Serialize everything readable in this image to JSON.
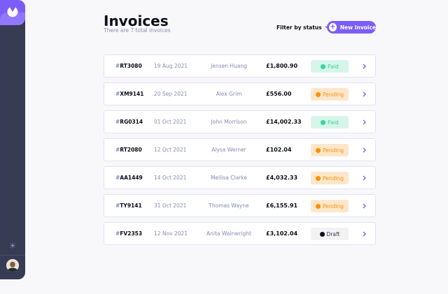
{
  "header": {
    "title": "Invoices",
    "subtitle": "There are 7 total invoices",
    "filter_label": "Filter by status",
    "new_button_label": "New Invoice"
  },
  "sidebar": {
    "logo_icon": "logo-icon",
    "theme_icon": "sun-icon",
    "theme_glyph": "☀",
    "avatar": "avatar"
  },
  "colors": {
    "accent": "#7c5dfa",
    "sidebar": "#373b53",
    "paid": "#33d69f",
    "pending": "#ff8f00",
    "draft": "#373b53"
  },
  "invoices": [
    {
      "hash": "#",
      "id": "RT3080",
      "due": "19 Aug 2021",
      "client": "Jensen Huang",
      "amount": "£1,800.90",
      "status": "Paid"
    },
    {
      "hash": "#",
      "id": "XM9141",
      "due": "20 Sep 2021",
      "client": "Alex Grim",
      "amount": "£556.00",
      "status": "Pending"
    },
    {
      "hash": "#",
      "id": "RG0314",
      "due": "01 Oct 2021",
      "client": "John Morrison",
      "amount": "£14,002.33",
      "status": "Paid"
    },
    {
      "hash": "#",
      "id": "RT2080",
      "due": "12 Oct 2021",
      "client": "Alysa Werner",
      "amount": "£102.04",
      "status": "Pending"
    },
    {
      "hash": "#",
      "id": "AA1449",
      "due": "14 Oct 2021",
      "client": "Mellisa Clarke",
      "amount": "£4,032.33",
      "status": "Pending"
    },
    {
      "hash": "#",
      "id": "TY9141",
      "due": "31 Oct 2021",
      "client": "Thomas Wayne",
      "amount": "£6,155.91",
      "status": "Pending"
    },
    {
      "hash": "#",
      "id": "FV2353",
      "due": "12 Nov 2021",
      "client": "Anita Wainwright",
      "amount": "£3,102.04",
      "status": "Draft"
    }
  ]
}
